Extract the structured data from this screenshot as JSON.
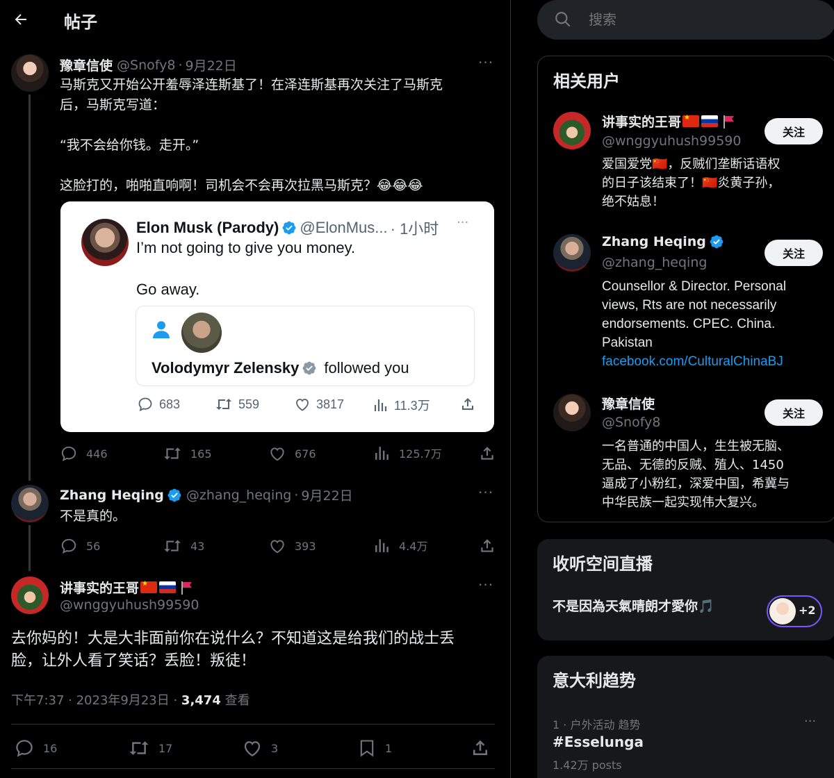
{
  "header": {
    "title": "帖子"
  },
  "thread": [
    {
      "name": "豫章信使",
      "handle": "@Snofy8",
      "date": "9月22日",
      "text_lines": [
        "马斯克又开始公开羞辱泽连斯基了！在泽连斯基再次关注了马斯克",
        "后，马斯克写道：",
        "",
        "“我不会给你钱。走开。”",
        "",
        "这脸打的，啪啪直响啊！司机会不会再次拉黑马斯克？😂😂😂"
      ],
      "actions": {
        "replies": "446",
        "reposts": "165",
        "likes": "676",
        "views": "125.7万"
      }
    },
    {
      "name": "Zhang Heqing",
      "handle": "@zhang_heqing",
      "date": "9月22日",
      "text": "不是真的。",
      "actions": {
        "replies": "56",
        "reposts": "43",
        "likes": "393",
        "views": "4.4万"
      }
    }
  ],
  "quote_image": {
    "name": "Elon Musk (Parody)",
    "handle": "@ElonMus...",
    "time": "· 1小时",
    "line1": "I’m not going to give you money.",
    "line2": "Go away.",
    "inner_name": "Volodymyr Zelensky",
    "inner_text": "followed you",
    "actions": {
      "replies": "683",
      "reposts": "559",
      "likes": "3817",
      "views": "11.3万"
    }
  },
  "main_post": {
    "name": "讲事实的王哥",
    "handle": "@wnggyuhush99590",
    "text_lines": [
      "去你妈的！大是大非面前你在说什么？不知道这是给我们的战士丢",
      "脸，让外人看了笑话？丢脸！叛徒！"
    ],
    "time": "下午7:37 · 2023年9月23日 · ",
    "views_count": "3,474",
    "views_label": " 查看",
    "actions": {
      "replies": "16",
      "reposts": "17",
      "likes": "3",
      "bookmarks": "1"
    }
  },
  "search": {
    "placeholder": "搜索"
  },
  "related_users": {
    "title": "相关用户",
    "follow_label": "关注",
    "users": [
      {
        "name": "讲事实的王哥",
        "handle": "@wnggyuhush99590",
        "bio_lines": [
          "爱国爱党🇨🇳，反贼们垄断话语权",
          "的日子该结束了！🇨🇳炎黄子孙，",
          "绝不姑息！"
        ]
      },
      {
        "name": "Zhang Heqing",
        "handle": "@zhang_heqing",
        "bio_lines": [
          "Counsellor & Director. Personal",
          "views, Rts are not necessarily",
          "endorsements. CPEC. China.",
          "Pakistan"
        ],
        "link": "facebook.com/CulturalChinaBJ"
      },
      {
        "name": "豫章信使",
        "handle": "@Snofy8",
        "bio_lines": [
          "一名普通的中国人，生生被无脑、",
          "无品、无德的反贼、殖人、1450",
          "逼成了小粉红，深爱中国，希冀与",
          "中华民族一起实现伟大复兴。"
        ]
      }
    ]
  },
  "spaces": {
    "title": "收听空间直播",
    "space_title": "不是因為天氣晴朗才愛你🎵",
    "extra_count": "+2"
  },
  "trends": {
    "title": "意大利趋势",
    "meta": "1 · 户外活动 趋势",
    "tag": "#Esselunga",
    "posts": "1.42万 posts"
  },
  "colors": {
    "accent": "#1d9bf0",
    "muted": "#71767b",
    "background": "#000000"
  }
}
